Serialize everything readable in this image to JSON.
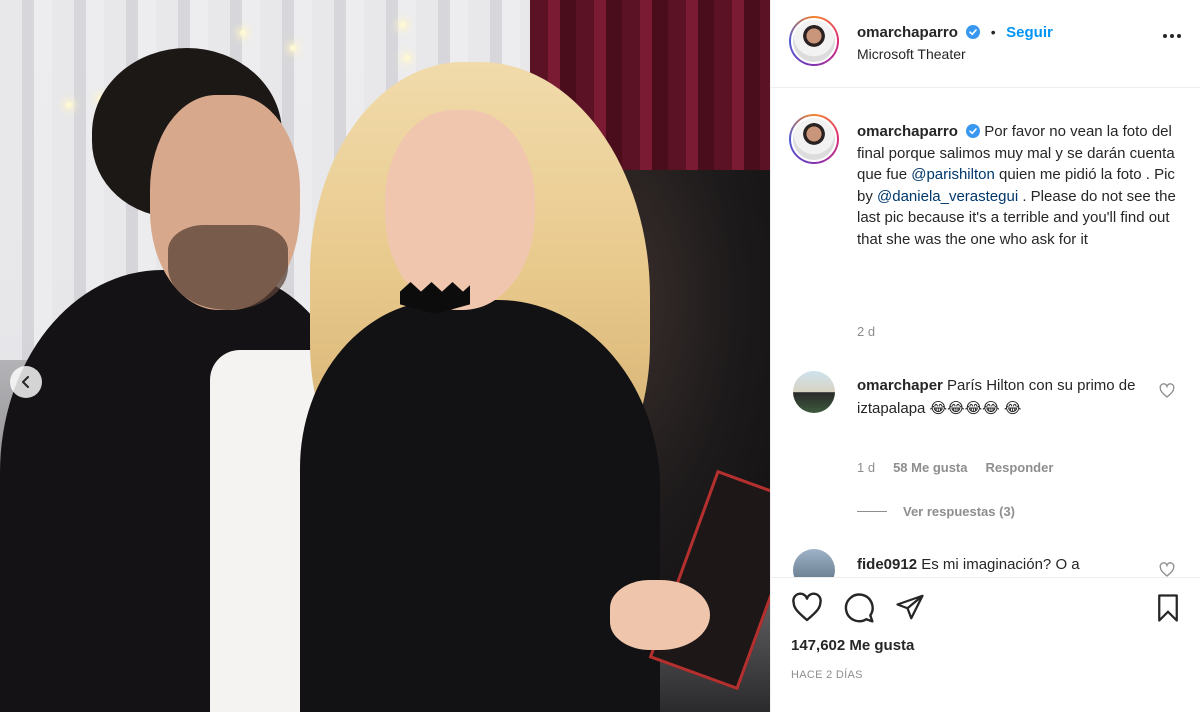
{
  "post": {
    "username": "omarchaparro",
    "follow_label": "Seguir",
    "separator": "•",
    "location": "Microsoft Theater",
    "caption": {
      "username": "omarchaparro",
      "part1": "Por favor no vean la foto del final porque salimos muy mal y se darán cuenta que fue ",
      "mention1": "@parishilton",
      "part2": " quien me pidió la foto . Pic by ",
      "mention2": "@daniela_verastegui",
      "part3": " . Please do not see the last pic because it's a terrible and you'll find out that she was the one who ask for it",
      "time": "2 d"
    },
    "comments": [
      {
        "username": "omarchaper",
        "text": "París Hilton con su primo de iztapalapa 😂😂😂😂 😂",
        "time": "1 d",
        "likes": "58 Me gusta",
        "reply_label": "Responder",
        "view_replies": "Ver respuestas (3)"
      },
      {
        "username": "fide0912",
        "text": "Es mi imaginación? O a"
      }
    ],
    "likes_count": "147,602 Me gusta",
    "time_ago": "HACE 2 DÍAS"
  },
  "colors": {
    "accent": "#0095f6",
    "mention": "#00376b",
    "muted": "#8e8e8e",
    "text": "#262626",
    "border": "#efefef"
  },
  "icons": {
    "verified": "verified-badge-icon",
    "more": "more-options-icon",
    "prev": "chevron-left-icon",
    "like": "heart-icon",
    "comment": "comment-icon",
    "share": "paper-plane-icon",
    "save": "bookmark-icon",
    "comment_like": "small-heart-icon"
  }
}
